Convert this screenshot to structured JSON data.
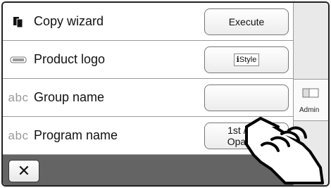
{
  "rows": [
    {
      "icon": "copy-icon",
      "label": "Copy wizard",
      "button": "Execute"
    },
    {
      "icon": "product-logo-icon",
      "label": "Product logo",
      "button": "Style"
    },
    {
      "icon_text": "abc",
      "label": "Group name",
      "button": ""
    },
    {
      "icon_text": "abc",
      "label": "Program name",
      "button_line1": "1st / 2nd",
      "button_line2": "Opaquer"
    }
  ],
  "close_label": "✕",
  "sidebar": {
    "tab_label": "Admin"
  }
}
